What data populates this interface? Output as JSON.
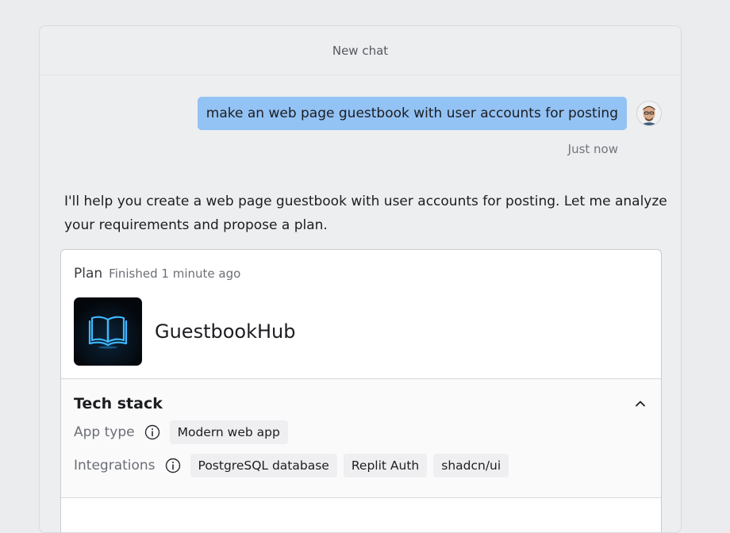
{
  "header": {
    "title": "New chat"
  },
  "user_message": {
    "text": "make an web page guestbook with user accounts for posting",
    "timestamp": "Just now"
  },
  "assistant_message": {
    "text": "I'll help you create a web page guestbook with user accounts for posting. Let me analyze your requirements and propose a plan."
  },
  "plan": {
    "title": "Plan",
    "status": "Finished 1 minute ago",
    "app_name": "GuestbookHub",
    "logo_icon": "open-book-icon",
    "tech_stack": {
      "title": "Tech stack",
      "app_type_label": "App type",
      "app_type_values": [
        "Modern web app"
      ],
      "integrations_label": "Integrations",
      "integrations_values": [
        "PostgreSQL database",
        "Replit Auth",
        "shadcn/ui"
      ]
    }
  },
  "colors": {
    "user_bubble": "#93c2f4",
    "logo_glow": "#3fb8ff"
  }
}
